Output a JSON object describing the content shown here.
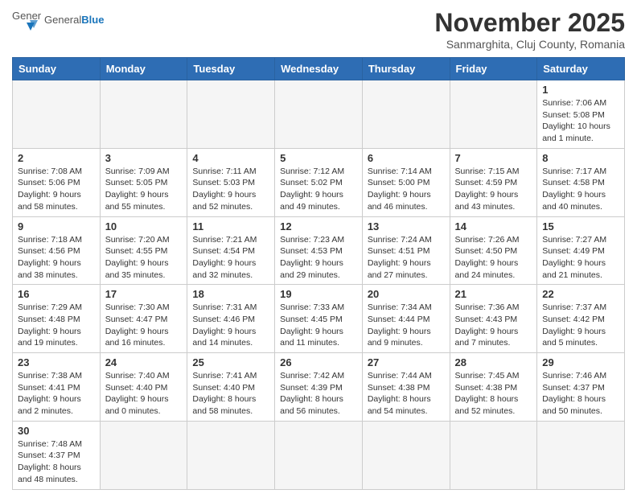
{
  "header": {
    "logo_text_general": "General",
    "logo_text_blue": "Blue",
    "month_title": "November 2025",
    "location": "Sanmarghita, Cluj County, Romania"
  },
  "days_of_week": [
    "Sunday",
    "Monday",
    "Tuesday",
    "Wednesday",
    "Thursday",
    "Friday",
    "Saturday"
  ],
  "weeks": [
    [
      {
        "day": "",
        "empty": true
      },
      {
        "day": "",
        "empty": true
      },
      {
        "day": "",
        "empty": true
      },
      {
        "day": "",
        "empty": true
      },
      {
        "day": "",
        "empty": true
      },
      {
        "day": "",
        "empty": true
      },
      {
        "day": "1",
        "sunrise": "7:06 AM",
        "sunset": "5:08 PM",
        "daylight": "10 hours and 1 minute."
      }
    ],
    [
      {
        "day": "2",
        "sunrise": "7:08 AM",
        "sunset": "5:06 PM",
        "daylight": "9 hours and 58 minutes."
      },
      {
        "day": "3",
        "sunrise": "7:09 AM",
        "sunset": "5:05 PM",
        "daylight": "9 hours and 55 minutes."
      },
      {
        "day": "4",
        "sunrise": "7:11 AM",
        "sunset": "5:03 PM",
        "daylight": "9 hours and 52 minutes."
      },
      {
        "day": "5",
        "sunrise": "7:12 AM",
        "sunset": "5:02 PM",
        "daylight": "9 hours and 49 minutes."
      },
      {
        "day": "6",
        "sunrise": "7:14 AM",
        "sunset": "5:00 PM",
        "daylight": "9 hours and 46 minutes."
      },
      {
        "day": "7",
        "sunrise": "7:15 AM",
        "sunset": "4:59 PM",
        "daylight": "9 hours and 43 minutes."
      },
      {
        "day": "8",
        "sunrise": "7:17 AM",
        "sunset": "4:58 PM",
        "daylight": "9 hours and 40 minutes."
      }
    ],
    [
      {
        "day": "9",
        "sunrise": "7:18 AM",
        "sunset": "4:56 PM",
        "daylight": "9 hours and 38 minutes."
      },
      {
        "day": "10",
        "sunrise": "7:20 AM",
        "sunset": "4:55 PM",
        "daylight": "9 hours and 35 minutes."
      },
      {
        "day": "11",
        "sunrise": "7:21 AM",
        "sunset": "4:54 PM",
        "daylight": "9 hours and 32 minutes."
      },
      {
        "day": "12",
        "sunrise": "7:23 AM",
        "sunset": "4:53 PM",
        "daylight": "9 hours and 29 minutes."
      },
      {
        "day": "13",
        "sunrise": "7:24 AM",
        "sunset": "4:51 PM",
        "daylight": "9 hours and 27 minutes."
      },
      {
        "day": "14",
        "sunrise": "7:26 AM",
        "sunset": "4:50 PM",
        "daylight": "9 hours and 24 minutes."
      },
      {
        "day": "15",
        "sunrise": "7:27 AM",
        "sunset": "4:49 PM",
        "daylight": "9 hours and 21 minutes."
      }
    ],
    [
      {
        "day": "16",
        "sunrise": "7:29 AM",
        "sunset": "4:48 PM",
        "daylight": "9 hours and 19 minutes."
      },
      {
        "day": "17",
        "sunrise": "7:30 AM",
        "sunset": "4:47 PM",
        "daylight": "9 hours and 16 minutes."
      },
      {
        "day": "18",
        "sunrise": "7:31 AM",
        "sunset": "4:46 PM",
        "daylight": "9 hours and 14 minutes."
      },
      {
        "day": "19",
        "sunrise": "7:33 AM",
        "sunset": "4:45 PM",
        "daylight": "9 hours and 11 minutes."
      },
      {
        "day": "20",
        "sunrise": "7:34 AM",
        "sunset": "4:44 PM",
        "daylight": "9 hours and 9 minutes."
      },
      {
        "day": "21",
        "sunrise": "7:36 AM",
        "sunset": "4:43 PM",
        "daylight": "9 hours and 7 minutes."
      },
      {
        "day": "22",
        "sunrise": "7:37 AM",
        "sunset": "4:42 PM",
        "daylight": "9 hours and 5 minutes."
      }
    ],
    [
      {
        "day": "23",
        "sunrise": "7:38 AM",
        "sunset": "4:41 PM",
        "daylight": "9 hours and 2 minutes."
      },
      {
        "day": "24",
        "sunrise": "7:40 AM",
        "sunset": "4:40 PM",
        "daylight": "9 hours and 0 minutes."
      },
      {
        "day": "25",
        "sunrise": "7:41 AM",
        "sunset": "4:40 PM",
        "daylight": "8 hours and 58 minutes."
      },
      {
        "day": "26",
        "sunrise": "7:42 AM",
        "sunset": "4:39 PM",
        "daylight": "8 hours and 56 minutes."
      },
      {
        "day": "27",
        "sunrise": "7:44 AM",
        "sunset": "4:38 PM",
        "daylight": "8 hours and 54 minutes."
      },
      {
        "day": "28",
        "sunrise": "7:45 AM",
        "sunset": "4:38 PM",
        "daylight": "8 hours and 52 minutes."
      },
      {
        "day": "29",
        "sunrise": "7:46 AM",
        "sunset": "4:37 PM",
        "daylight": "8 hours and 50 minutes."
      }
    ],
    [
      {
        "day": "30",
        "sunrise": "7:48 AM",
        "sunset": "4:37 PM",
        "daylight": "8 hours and 48 minutes."
      },
      {
        "day": "",
        "empty": true
      },
      {
        "day": "",
        "empty": true
      },
      {
        "day": "",
        "empty": true
      },
      {
        "day": "",
        "empty": true
      },
      {
        "day": "",
        "empty": true
      },
      {
        "day": "",
        "empty": true
      }
    ]
  ]
}
